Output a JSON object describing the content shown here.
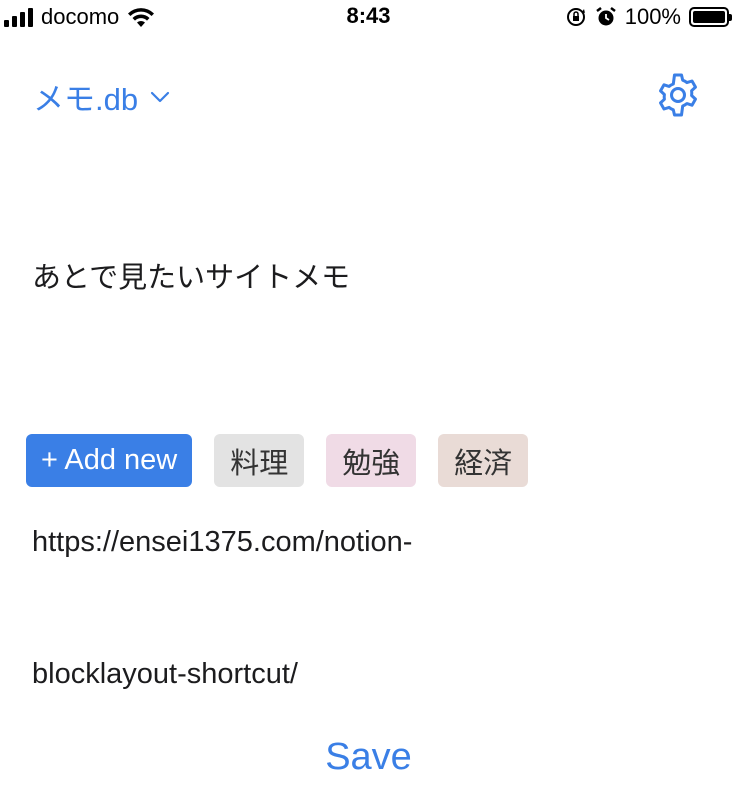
{
  "status_bar": {
    "carrier": "docomo",
    "time": "8:43",
    "battery": "100%"
  },
  "header": {
    "db_name": "メモ.db",
    "accent_color": "#3a7fe6"
  },
  "memo": {
    "title": "あとで見たいサイトメモ",
    "url_line1": "https://ensei1375.com/notion-",
    "url_line2": "blocklayout-shortcut/"
  },
  "tags": {
    "add_label": "+ Add new",
    "items": [
      {
        "label": "料理",
        "color": "#e3e3e3"
      },
      {
        "label": "勉強",
        "color": "#f0dbe6"
      },
      {
        "label": "経済",
        "color": "#e9dbd6"
      }
    ]
  },
  "footer": {
    "save_label": "Save"
  }
}
